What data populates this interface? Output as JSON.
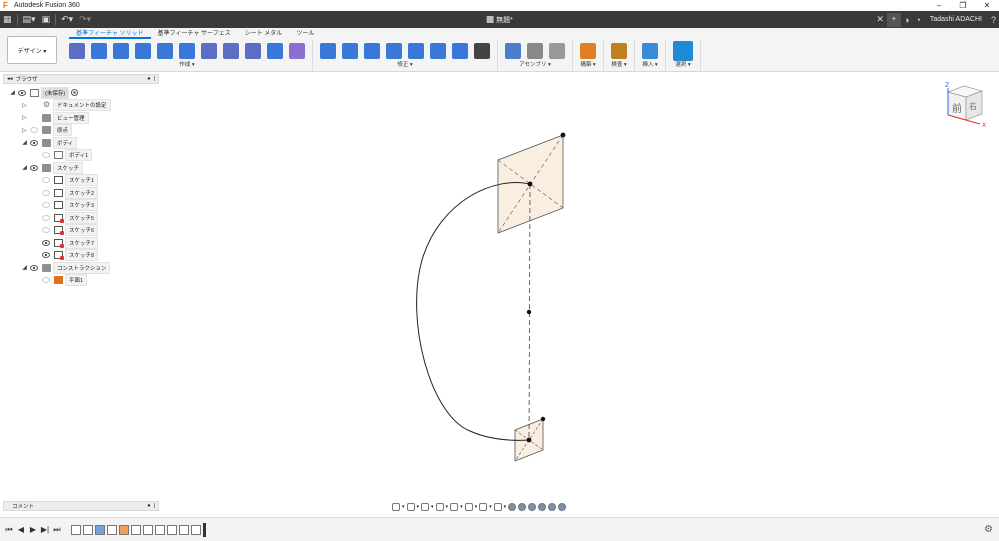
{
  "window": {
    "app_title": "Autodesk Fusion 360",
    "minimize": "–",
    "maximize": "❐",
    "close": "✕"
  },
  "appbar": {
    "doc_title": "無題*",
    "user_name": "Tadashi ADACHI",
    "help": "?"
  },
  "ribbon": {
    "workspace": "デザイン ▾",
    "tabs": [
      "基準フィーチャ ソリッド",
      "基準フィーチャ サーフェス",
      "シート メタル",
      "ツール"
    ],
    "active_tab": 0,
    "groups": [
      {
        "label": "作成 ▾",
        "icons": [
          "new-sketch-icon",
          "extrude-icon",
          "revolve-icon",
          "sweep-icon",
          "loft-icon",
          "rib-icon",
          "web-icon",
          "emboss-icon",
          "hole-icon",
          "thread-icon",
          "pattern-icon"
        ]
      },
      {
        "label": "修正 ▾",
        "icons": [
          "press-pull-icon",
          "fillet-icon",
          "chamfer-icon",
          "shell-icon",
          "draft-icon",
          "scale-icon",
          "combine-icon",
          "move-icon"
        ]
      },
      {
        "label": "アセンブリ ▾",
        "icons": [
          "new-component-icon",
          "joint-icon",
          "as-built-joint-icon"
        ]
      },
      {
        "label": "構築 ▾",
        "icons": [
          "offset-plane-icon"
        ]
      },
      {
        "label": "検査 ▾",
        "icons": [
          "measure-icon"
        ]
      },
      {
        "label": "挿入 ▾",
        "icons": [
          "insert-image-icon"
        ]
      },
      {
        "label": "選択 ▾",
        "icons": [
          "select-icon"
        ]
      }
    ]
  },
  "browser": {
    "title": "ブラウザ",
    "items": [
      {
        "label": "(未保存)",
        "level": 0,
        "twisty": "◢",
        "eye": "on",
        "icon": "document",
        "root": true
      },
      {
        "label": "ドキュメントの設定",
        "level": 1,
        "twisty": "▷",
        "eye": "none",
        "icon": "gear"
      },
      {
        "label": "ビュー管理",
        "level": 1,
        "twisty": "▷",
        "eye": "none",
        "icon": "folder"
      },
      {
        "label": "原点",
        "level": 1,
        "twisty": "▷",
        "eye": "off",
        "icon": "folder"
      },
      {
        "label": "ボディ",
        "level": 1,
        "twisty": "◢",
        "eye": "on",
        "icon": "folder"
      },
      {
        "label": "ボディ1",
        "level": 2,
        "twisty": "",
        "eye": "off",
        "icon": "body"
      },
      {
        "label": "スケッチ",
        "level": 1,
        "twisty": "◢",
        "eye": "on",
        "icon": "folder"
      },
      {
        "label": "スケッチ1",
        "level": 2,
        "twisty": "",
        "eye": "off",
        "icon": "sketch"
      },
      {
        "label": "スケッチ2",
        "level": 2,
        "twisty": "",
        "eye": "off",
        "icon": "sketch"
      },
      {
        "label": "スケッチ3",
        "level": 2,
        "twisty": "",
        "eye": "off",
        "icon": "sketch"
      },
      {
        "label": "スケッチ5",
        "level": 2,
        "twisty": "",
        "eye": "off",
        "icon": "sketch-red"
      },
      {
        "label": "スケッチ6",
        "level": 2,
        "twisty": "",
        "eye": "off",
        "icon": "sketch-red"
      },
      {
        "label": "スケッチ7",
        "level": 2,
        "twisty": "",
        "eye": "on",
        "icon": "sketch-red"
      },
      {
        "label": "スケッチ8",
        "level": 2,
        "twisty": "",
        "eye": "on",
        "icon": "sketch-red"
      },
      {
        "label": "コンストラクション",
        "level": 1,
        "twisty": "◢",
        "eye": "on",
        "icon": "folder"
      },
      {
        "label": "平面1",
        "level": 2,
        "twisty": "",
        "eye": "off",
        "icon": "plane"
      }
    ]
  },
  "comment_panel": {
    "title": "コメント"
  },
  "viewcube": {
    "face_front": "前",
    "face_right": "右",
    "axis_z": "Z",
    "axis_x": "X"
  },
  "navbar": {
    "icons": [
      "orbit-icon",
      "look-at-icon",
      "pan-icon",
      "zoom-icon",
      "fit-icon",
      "display-settings-icon",
      "grid-icon",
      "viewports-icon"
    ]
  },
  "timeline": {
    "controls": [
      "⏮",
      "◀",
      "▶",
      "▶|",
      "⏭"
    ],
    "features": [
      "sketch",
      "sketch",
      "extrude",
      "sketch",
      "plane",
      "sketch",
      "sketch",
      "sketch",
      "sketch",
      "sketch",
      "sketch"
    ]
  },
  "colors": {
    "accent": "#0078d7",
    "plane_fill": "#faeee0",
    "appbar": "#3a3a3a",
    "ribbon_bg": "#f4f4f4"
  }
}
